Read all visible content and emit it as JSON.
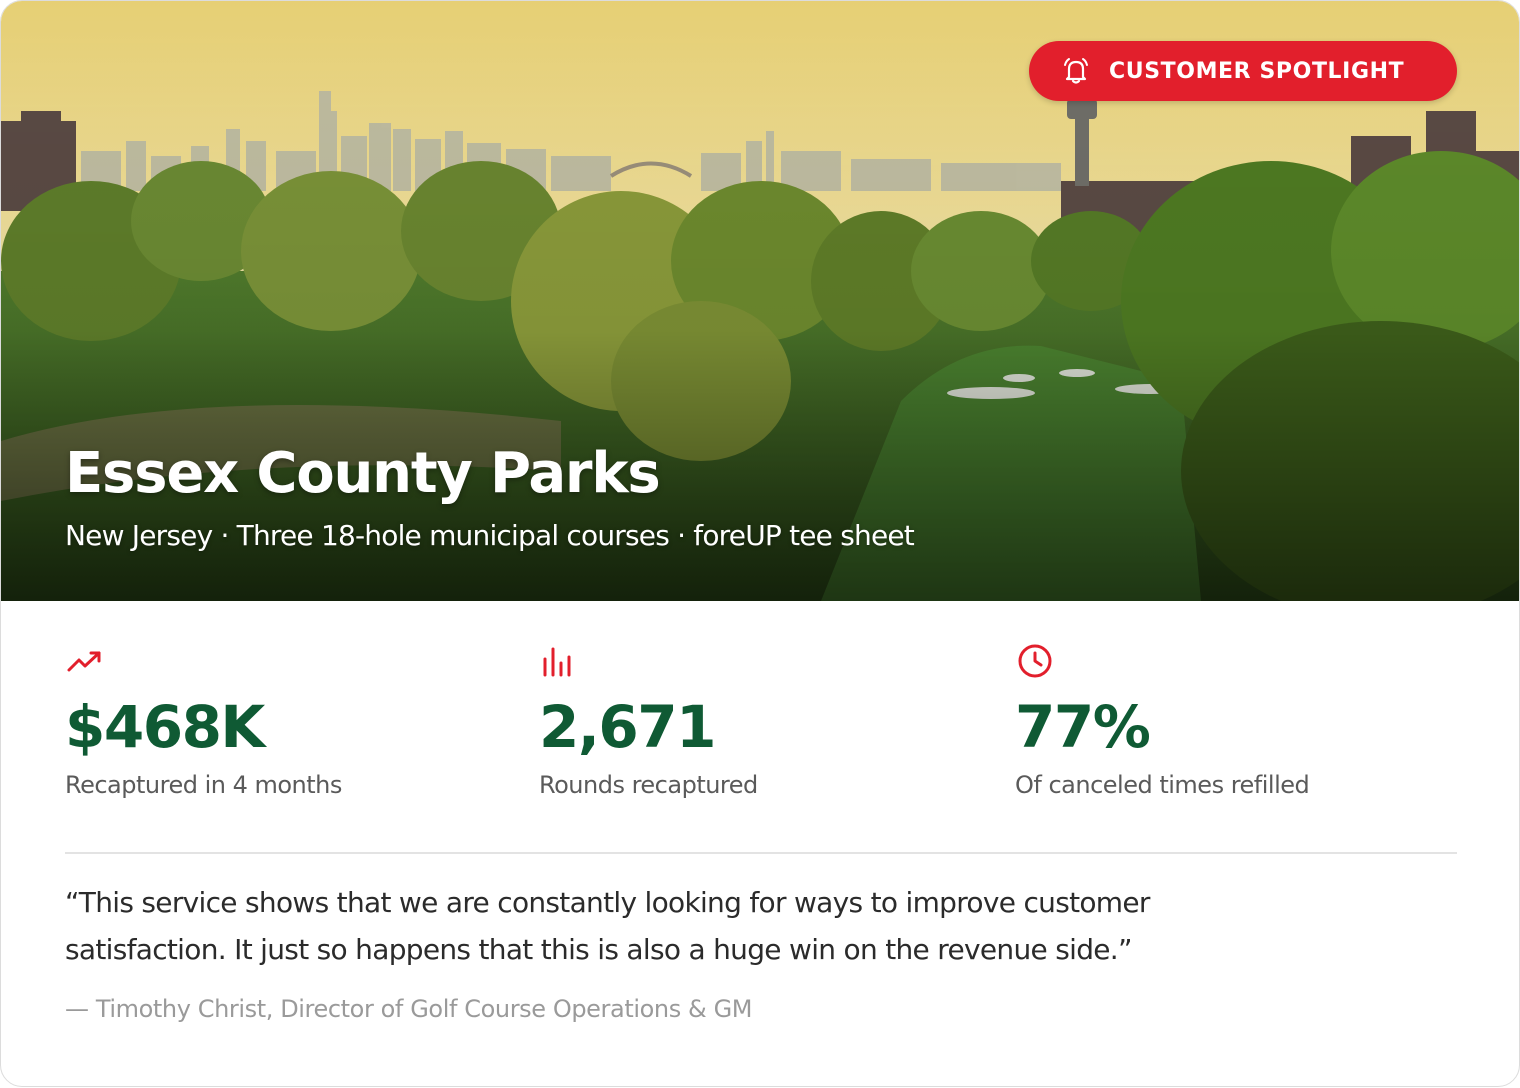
{
  "badge": {
    "label": "CUSTOMER SPOTLIGHT",
    "icon": "bell-icon",
    "color": "#e21f2c"
  },
  "hero": {
    "title": "Essex County Parks",
    "subtitle": "New Jersey · Three 18-hole municipal courses · foreUP tee sheet",
    "image": "golf-course-with-city-skyline"
  },
  "stats": [
    {
      "icon": "trending-up-icon",
      "value": "$468K",
      "label": "Recaptured in 4 months"
    },
    {
      "icon": "bar-chart-icon",
      "value": "2,671",
      "label": "Rounds recaptured"
    },
    {
      "icon": "clock-icon",
      "value": "77%",
      "label": "Of canceled times refilled"
    }
  ],
  "testimonial": {
    "quote": "“This service shows that we are constantly looking for ways to improve customer satisfaction. It just so happens that this is also a huge win on the revenue side.”",
    "attribution": "— Timothy Christ, Director of Golf Course Operations & GM"
  },
  "colors": {
    "accent": "#e21f2c",
    "stat_value": "#0f5a34",
    "label": "#5a5a5a",
    "muted": "#9a9a9a"
  }
}
